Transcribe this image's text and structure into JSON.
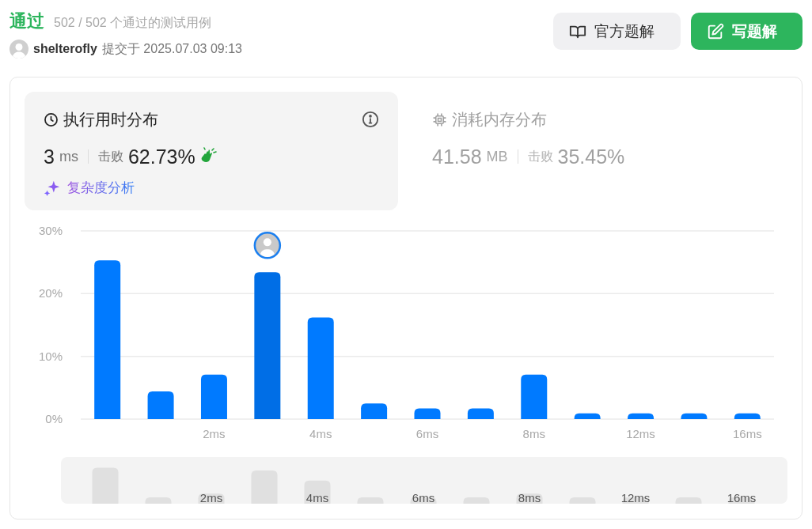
{
  "status": {
    "verdict": "通过",
    "tests": "502 / 502 个通过的测试用例"
  },
  "submission": {
    "user": "shelterofly",
    "submitted": "提交于 2025.07.03 09:13"
  },
  "buttons": [
    {
      "label": "官方题解",
      "kind": "secondary"
    },
    {
      "label": "写题解",
      "kind": "primary"
    }
  ],
  "metrics": [
    {
      "kind": "runtime",
      "title": "执行用时分布",
      "value": "3",
      "unit": "ms",
      "beats_label": "击败",
      "beats": "62.73%",
      "selected": true,
      "link": "复杂度分析"
    },
    {
      "kind": "memory",
      "title": "消耗内存分布",
      "value": "41.58",
      "unit": "MB",
      "beats_label": "击败",
      "beats": "35.45%",
      "selected": false
    }
  ],
  "chart_data": {
    "type": "bar",
    "ylim": [
      0,
      30
    ],
    "yticks": [
      {
        "value": 0,
        "label": "0%"
      },
      {
        "value": 10,
        "label": "10%"
      },
      {
        "value": 20,
        "label": "20%"
      },
      {
        "value": 30,
        "label": "30%"
      }
    ],
    "categories": [
      null,
      null,
      "2ms",
      null,
      "4ms",
      null,
      "6ms",
      null,
      "8ms",
      null,
      "12ms",
      null,
      "16ms"
    ],
    "series": [
      {
        "color": "#007aff",
        "values": [
          25.3,
          4.4,
          7.1,
          23.4,
          16.2,
          2.5,
          1.7,
          1.7,
          7.1,
          0.9,
          0.9,
          0.9,
          0.9
        ]
      }
    ]
  },
  "histogram_bars": [
    {
      "selected": false
    },
    {
      "selected": false
    },
    {
      "selected": false
    },
    {
      "selected": true
    },
    {
      "selected": false
    },
    {
      "selected": false
    },
    {
      "selected": false
    },
    {
      "selected": false
    },
    {
      "selected": false
    },
    {
      "selected": false
    },
    {
      "selected": false
    },
    {
      "selected": false
    },
    {
      "selected": false
    }
  ],
  "overview": {
    "labels": [
      "2ms",
      "4ms",
      "6ms",
      "8ms",
      "12ms",
      "16ms"
    ]
  }
}
